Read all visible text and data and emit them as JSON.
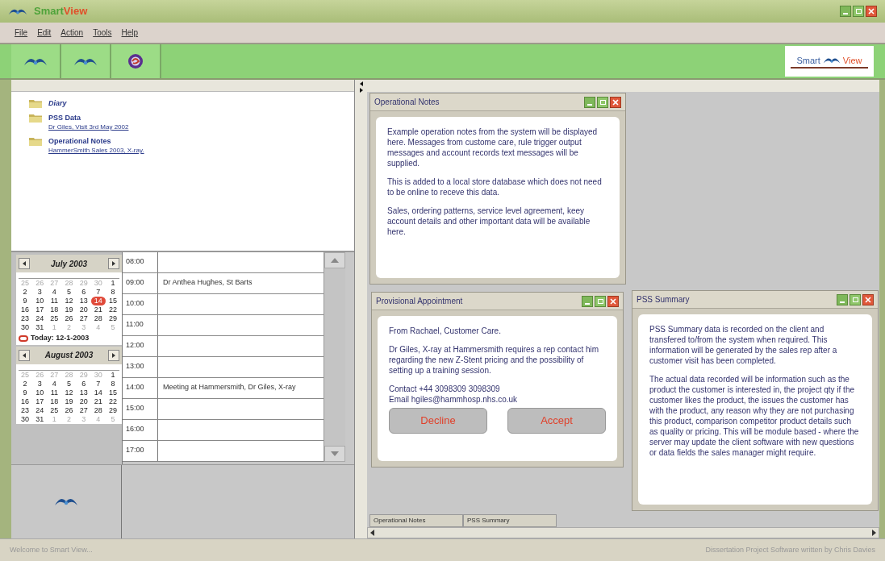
{
  "app": {
    "title": [
      {
        "text": "Smart",
        "color": "#4fa33a"
      },
      {
        "text": "View",
        "color": "#e0502a"
      }
    ]
  },
  "menu": [
    "File",
    "Edit",
    "Action",
    "Tools",
    "Help"
  ],
  "toolbar": [
    {
      "kind": "logo"
    },
    {
      "kind": "logo"
    },
    {
      "kind": "emblem"
    }
  ],
  "brand": [
    {
      "text": "Smart",
      "color": "#3a5fa0"
    },
    {
      "text": "View",
      "color": "#e0502a"
    }
  ],
  "tree": [
    {
      "label": "Diary",
      "kind": "heading"
    },
    {
      "label": "PSS Data",
      "kind": "folder",
      "link": "Dr Giles, Visit 3rd May 2002"
    },
    {
      "label": "Operational Notes",
      "kind": "folder",
      "link": "HammerSmith Sales 2003, X-ray."
    }
  ],
  "calendars": [
    {
      "month": "July 2003",
      "today": "Today: 12-1-2003",
      "days": [
        {
          "d": "25",
          "muted": true,
          "selected": false
        },
        {
          "d": "26",
          "muted": true,
          "selected": false
        },
        {
          "d": "27",
          "muted": true,
          "selected": false
        },
        {
          "d": "28",
          "muted": true,
          "selected": false
        },
        {
          "d": "29",
          "muted": true,
          "selected": false
        },
        {
          "d": "30",
          "muted": true,
          "selected": false
        },
        {
          "d": "1",
          "muted": false,
          "selected": false
        },
        {
          "d": "2",
          "muted": false,
          "selected": false
        },
        {
          "d": "3",
          "muted": false,
          "selected": false
        },
        {
          "d": "4",
          "muted": false,
          "selected": false
        },
        {
          "d": "5",
          "muted": false,
          "selected": false
        },
        {
          "d": "6",
          "muted": false,
          "selected": false
        },
        {
          "d": "7",
          "muted": false,
          "selected": false
        },
        {
          "d": "8",
          "muted": false,
          "selected": false
        },
        {
          "d": "9",
          "muted": false,
          "selected": false
        },
        {
          "d": "10",
          "muted": false,
          "selected": false
        },
        {
          "d": "11",
          "muted": false,
          "selected": false
        },
        {
          "d": "12",
          "muted": false,
          "selected": false
        },
        {
          "d": "13",
          "muted": false,
          "selected": false
        },
        {
          "d": "14",
          "muted": false,
          "selected": true
        },
        {
          "d": "15",
          "muted": false,
          "selected": false
        },
        {
          "d": "16",
          "muted": false,
          "selected": false
        },
        {
          "d": "17",
          "muted": false,
          "selected": false
        },
        {
          "d": "18",
          "muted": false,
          "selected": false
        },
        {
          "d": "19",
          "muted": false,
          "selected": false
        },
        {
          "d": "20",
          "muted": false,
          "selected": false
        },
        {
          "d": "21",
          "muted": false,
          "selected": false
        },
        {
          "d": "22",
          "muted": false,
          "selected": false
        },
        {
          "d": "23",
          "muted": false,
          "selected": false
        },
        {
          "d": "24",
          "muted": false,
          "selected": false
        },
        {
          "d": "25",
          "muted": false,
          "selected": false
        },
        {
          "d": "26",
          "muted": false,
          "selected": false
        },
        {
          "d": "27",
          "muted": false,
          "selected": false
        },
        {
          "d": "28",
          "muted": false,
          "selected": false
        },
        {
          "d": "29",
          "muted": false,
          "selected": false
        },
        {
          "d": "30",
          "muted": false,
          "selected": false
        },
        {
          "d": "31",
          "muted": false,
          "selected": false
        },
        {
          "d": "1",
          "muted": true,
          "selected": false
        },
        {
          "d": "2",
          "muted": true,
          "selected": false
        },
        {
          "d": "3",
          "muted": true,
          "selected": false
        },
        {
          "d": "4",
          "muted": true,
          "selected": false
        },
        {
          "d": "5",
          "muted": true,
          "selected": false
        }
      ]
    },
    {
      "month": "August 2003",
      "days": [
        {
          "d": "25",
          "muted": true,
          "selected": false
        },
        {
          "d": "26",
          "muted": true,
          "selected": false
        },
        {
          "d": "27",
          "muted": true,
          "selected": false
        },
        {
          "d": "28",
          "muted": true,
          "selected": false
        },
        {
          "d": "29",
          "muted": true,
          "selected": false
        },
        {
          "d": "30",
          "muted": true,
          "selected": false
        },
        {
          "d": "1",
          "muted": false,
          "selected": false
        },
        {
          "d": "2",
          "muted": false,
          "selected": false
        },
        {
          "d": "3",
          "muted": false,
          "selected": false
        },
        {
          "d": "4",
          "muted": false,
          "selected": false
        },
        {
          "d": "5",
          "muted": false,
          "selected": false
        },
        {
          "d": "6",
          "muted": false,
          "selected": false
        },
        {
          "d": "7",
          "muted": false,
          "selected": false
        },
        {
          "d": "8",
          "muted": false,
          "selected": false
        },
        {
          "d": "9",
          "muted": false,
          "selected": false
        },
        {
          "d": "10",
          "muted": false,
          "selected": false
        },
        {
          "d": "11",
          "muted": false,
          "selected": false
        },
        {
          "d": "12",
          "muted": false,
          "selected": false
        },
        {
          "d": "13",
          "muted": false,
          "selected": false
        },
        {
          "d": "14",
          "muted": false,
          "selected": false
        },
        {
          "d": "15",
          "muted": false,
          "selected": false
        },
        {
          "d": "16",
          "muted": false,
          "selected": false
        },
        {
          "d": "17",
          "muted": false,
          "selected": false
        },
        {
          "d": "18",
          "muted": false,
          "selected": false
        },
        {
          "d": "19",
          "muted": false,
          "selected": false
        },
        {
          "d": "20",
          "muted": false,
          "selected": false
        },
        {
          "d": "21",
          "muted": false,
          "selected": false
        },
        {
          "d": "22",
          "muted": false,
          "selected": false
        },
        {
          "d": "23",
          "muted": false,
          "selected": false
        },
        {
          "d": "24",
          "muted": false,
          "selected": false
        },
        {
          "d": "25",
          "muted": false,
          "selected": false
        },
        {
          "d": "26",
          "muted": false,
          "selected": false
        },
        {
          "d": "27",
          "muted": false,
          "selected": false
        },
        {
          "d": "28",
          "muted": false,
          "selected": false
        },
        {
          "d": "29",
          "muted": false,
          "selected": false
        },
        {
          "d": "30",
          "muted": false,
          "selected": false
        },
        {
          "d": "31",
          "muted": false,
          "selected": false
        },
        {
          "d": "1",
          "muted": true,
          "selected": false
        },
        {
          "d": "2",
          "muted": true,
          "selected": false
        },
        {
          "d": "3",
          "muted": true,
          "selected": false
        },
        {
          "d": "4",
          "muted": true,
          "selected": false
        },
        {
          "d": "5",
          "muted": true,
          "selected": false
        }
      ]
    }
  ],
  "schedule": [
    {
      "time": "08:00"
    },
    {
      "time": "09:00",
      "entry": "Dr Anthea Hughes, St Barts"
    },
    {
      "time": "10:00"
    },
    {
      "time": "11:00"
    },
    {
      "time": "12:00"
    },
    {
      "time": "13:00"
    },
    {
      "time": "14:00",
      "entry": "Meeting at Hammersmith, Dr Giles, X-ray"
    },
    {
      "time": "15:00"
    },
    {
      "time": "16:00"
    },
    {
      "time": "17:00"
    }
  ],
  "windows": [
    {
      "title": "Operational Notes",
      "kind": "notes",
      "paragraphs": [
        [
          "Example operation notes from the system will be displayed here. Messages from custome care, rule trigger output messages and account records text messages will be supplied."
        ],
        [
          "This is added to a local store database which does not need to be online to receve this data."
        ],
        [
          "Sales, ordering patterns, service level agreement, keey account details and other important data will be available here."
        ]
      ]
    },
    {
      "title": "Provisional Appointment",
      "kind": "appointment",
      "paragraphs": [
        [
          "From Rachael, Customer Care."
        ],
        [
          "Dr Giles, X-ray at Hammersmith requires a rep contact him regarding the new Z-Stent pricing and the possibility of setting up a training session."
        ],
        [
          "Contact +44 3098309 3098309",
          "Email hgiles@hammhosp.nhs.co.uk"
        ]
      ],
      "buttons": [
        "Decline",
        "Accept"
      ]
    },
    {
      "title": "PSS Summary",
      "kind": "notes",
      "paragraphs": [
        [
          "PSS Summary data is recorded on the client and transfered to/from the system when required. This information will be generated by the sales rep after a customer visit has been completed."
        ],
        [
          "The actual data recorded will be information such as the product the customer is interested in, the project qty if the customer likes the product, the issues the customer has with the product, any reason why they are not purchasing this product, comparison competitor product details such as quality or pricing. This will be module based - where the server may update the client software with new questions or data fields the sales manager might require."
        ]
      ]
    }
  ],
  "window_tabs": [
    "Operational Notes",
    "PSS Summary"
  ],
  "status_bar": {
    "left": "Welcome to Smart View...",
    "right": "Dissertation Project Software written by Chris Davies"
  }
}
